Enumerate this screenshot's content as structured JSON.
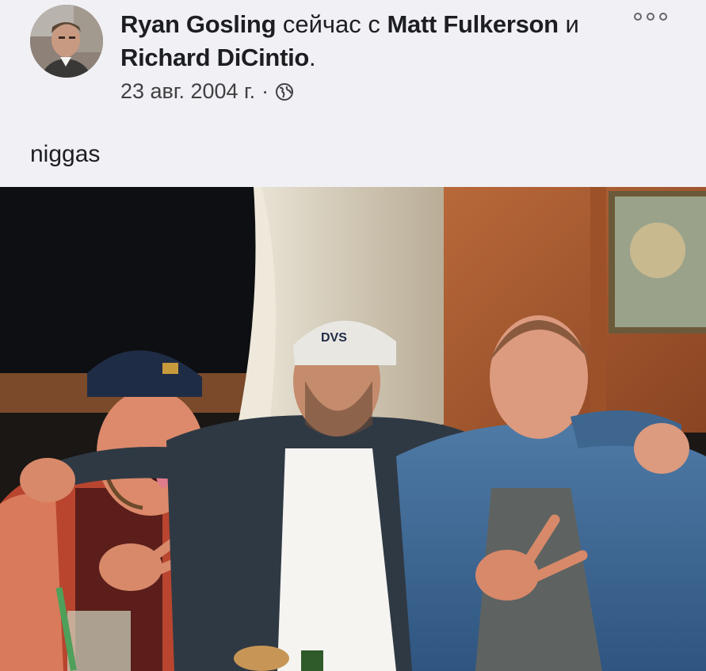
{
  "post": {
    "author": "Ryan Gosling",
    "with_text": "сейчас с",
    "tagged_1": "Matt Fulkerson",
    "and_text": "и",
    "tagged_2": "Richard DiCintio",
    "period": ".",
    "date": "23 авг. 2004 г.",
    "separator": "·",
    "privacy_icon": "globe-icon",
    "more_icon": "more-options-icon",
    "text": "niggas"
  },
  "photo": {
    "cap_logo": "DVS"
  },
  "colors": {
    "background": "#f1f0f4",
    "text": "#1c1e21",
    "secondary_text": "#3e4042"
  }
}
